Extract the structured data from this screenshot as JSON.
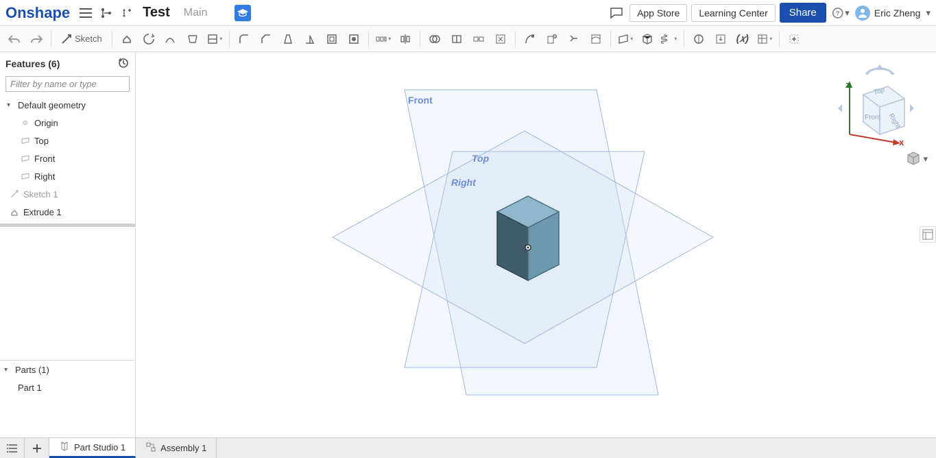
{
  "app": {
    "logo": "Onshape"
  },
  "header": {
    "doc_name": "Test",
    "sub_name": "Main",
    "buttons": {
      "app_store": "App Store",
      "learning": "Learning Center",
      "share": "Share"
    },
    "user": "Eric Zheng"
  },
  "toolbar": {
    "sketch_label": "Sketch"
  },
  "sidebar": {
    "features_header": "Features (6)",
    "filter_placeholder": "Filter by name or type",
    "default_geometry": "Default geometry",
    "geom": {
      "origin": "Origin",
      "top": "Top",
      "front": "Front",
      "right": "Right"
    },
    "sketch1": "Sketch 1",
    "extrude1": "Extrude 1",
    "parts_header": "Parts (1)",
    "part1": "Part 1"
  },
  "viewport": {
    "planes": {
      "front": "Front",
      "top": "Top",
      "right": "Right"
    }
  },
  "viewcube": {
    "z": "z",
    "x": "x",
    "top": "Top",
    "front": "Front",
    "right": "Right"
  },
  "tabs": {
    "part_studio": "Part Studio 1",
    "assembly": "Assembly 1"
  }
}
